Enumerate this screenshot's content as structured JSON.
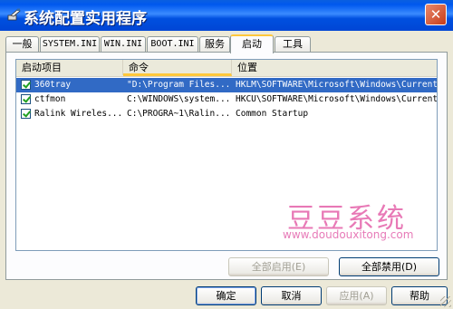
{
  "window": {
    "title": "系统配置实用程序",
    "close_glyph": "✕"
  },
  "tabs": [
    "一般",
    "SYSTEM.INI",
    "WIN.INI",
    "BOOT.INI",
    "服务",
    "启动",
    "工具"
  ],
  "active_tab_index": 5,
  "list": {
    "columns": [
      "启动项目",
      "命令",
      "位置"
    ],
    "rows": [
      {
        "checked": true,
        "name": "360tray",
        "command": "\"D:\\Program Files...",
        "location": "HKLM\\SOFTWARE\\Microsoft\\Windows\\Current...",
        "selected": true
      },
      {
        "checked": true,
        "name": "ctfmon",
        "command": "C:\\WINDOWS\\system...",
        "location": "HKCU\\SOFTWARE\\Microsoft\\Windows\\Current...",
        "selected": false
      },
      {
        "checked": true,
        "name": "Ralink Wireles...",
        "command": "C:\\PROGRA~1\\Ralin...",
        "location": "Common Startup",
        "selected": false
      }
    ]
  },
  "watermark": {
    "text": "豆豆系统",
    "url": "www.doudouxitong.com"
  },
  "panel_buttons": {
    "enable_all": "全部启用(E)",
    "disable_all": "全部禁用(D)"
  },
  "dialog_buttons": {
    "ok": "确定",
    "cancel": "取消",
    "apply": "应用(A)",
    "help": "帮助"
  },
  "colors": {
    "title_bar": "#0058EE",
    "selection": "#316AC5",
    "watermark": "#E879B6"
  }
}
